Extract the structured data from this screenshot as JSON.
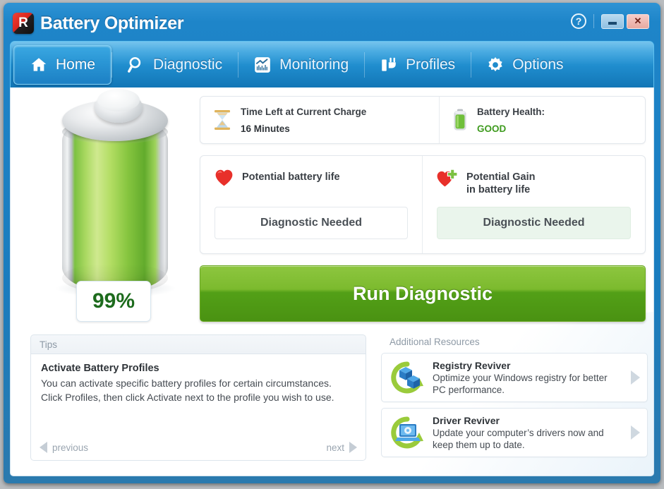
{
  "window": {
    "title": "Battery Optimizer",
    "logo_icon": "reviversoft-r-logo-icon",
    "help_label": "?",
    "minimize_label": "",
    "close_label": "✕",
    "accent_blue": "#1a7cbe",
    "accent_green": "#7cba2e"
  },
  "tabs": [
    {
      "label": "Home",
      "icon": "home-icon",
      "active": true
    },
    {
      "label": "Diagnostic",
      "icon": "magnifier-icon",
      "active": false
    },
    {
      "label": "Monitoring",
      "icon": "chart-icon",
      "active": false
    },
    {
      "label": "Profiles",
      "icon": "power-plug-icon",
      "active": false
    },
    {
      "label": "Options",
      "icon": "gear-icon",
      "active": false
    }
  ],
  "battery": {
    "percent_label": "99%",
    "icon": "battery-cylinder-icon",
    "fill_color": "#8dc63f"
  },
  "status": {
    "time_left": {
      "icon": "hourglass-icon",
      "label": "Time Left at Current Charge",
      "value": "16 Minutes"
    },
    "health": {
      "icon": "battery-health-icon",
      "label": "Battery Health:",
      "value": "GOOD",
      "value_color": "#3f9b1f"
    }
  },
  "potential": {
    "life": {
      "icon": "heart-icon",
      "title": "Potential battery life",
      "value": "Diagnostic Needed"
    },
    "gain": {
      "icon": "heart-plus-icon",
      "title_line1": "Potential Gain",
      "title_line2": "in battery life",
      "value": "Diagnostic Needed"
    }
  },
  "run_diagnostic": {
    "label": "Run Diagnostic"
  },
  "tips": {
    "header": "Tips",
    "title": "Activate Battery Profiles",
    "text": "You can activate specific battery profiles for certain circumstances. Click Profiles, then click Activate next to the profile you wish to use.",
    "previous_label": "previous",
    "next_label": "next"
  },
  "resources": {
    "header": "Additional Resources",
    "items": [
      {
        "icon": "registry-reviver-icon",
        "title": "Registry Reviver",
        "desc": "Optimize your Windows registry for better PC performance."
      },
      {
        "icon": "driver-reviver-icon",
        "title": "Driver Reviver",
        "desc": "Update your computer’s drivers now and keep them up to date."
      }
    ]
  }
}
